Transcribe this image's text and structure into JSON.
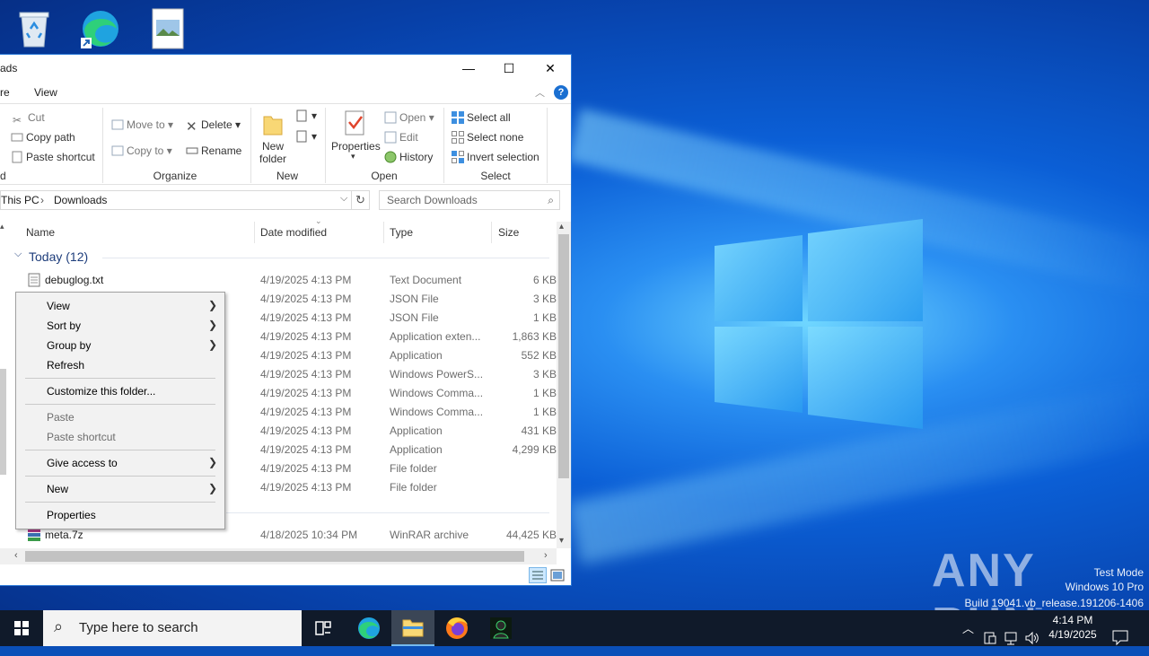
{
  "window": {
    "title": "ads",
    "tabs": [
      "re",
      "View"
    ],
    "minimize": "—",
    "maximize": "☐",
    "close": "✕"
  },
  "ribbon": {
    "clipboard": {
      "cut": "Cut",
      "copy_path": "Copy path",
      "paste_shortcut": "Paste shortcut",
      "group": "d"
    },
    "organize": {
      "move_to": "Move to",
      "copy_to": "Copy to",
      "delete": "Delete",
      "rename": "Rename",
      "group": "Organize"
    },
    "new": {
      "new_folder_line1": "New",
      "new_folder_line2": "folder",
      "group": "New"
    },
    "open": {
      "properties": "Properties",
      "open": "Open",
      "edit": "Edit",
      "history": "History",
      "group": "Open"
    },
    "select": {
      "select_all": "Select all",
      "select_none": "Select none",
      "invert": "Invert selection",
      "group": "Select"
    }
  },
  "address": {
    "path": [
      "This PC",
      "Downloads"
    ],
    "search_placeholder": "Search Downloads"
  },
  "columns": {
    "name": "Name",
    "date": "Date modified",
    "type": "Type",
    "size": "Size"
  },
  "group_today": "Today (12)",
  "files": [
    {
      "name": "debuglog.txt",
      "date": "4/19/2025 4:13 PM",
      "type": "Text Document",
      "size": "6 KB"
    },
    {
      "name": "",
      "date": "4/19/2025 4:13 PM",
      "type": "JSON File",
      "size": "3 KB"
    },
    {
      "name": "",
      "date": "4/19/2025 4:13 PM",
      "type": "JSON File",
      "size": "1 KB"
    },
    {
      "name": "",
      "date": "4/19/2025 4:13 PM",
      "type": "Application exten...",
      "size": "1,863 KB"
    },
    {
      "name": "",
      "date": "4/19/2025 4:13 PM",
      "type": "Application",
      "size": "552 KB"
    },
    {
      "name": "",
      "date": "4/19/2025 4:13 PM",
      "type": "Windows PowerS...",
      "size": "3 KB"
    },
    {
      "name": "",
      "date": "4/19/2025 4:13 PM",
      "type": "Windows Comma...",
      "size": "1 KB"
    },
    {
      "name": "",
      "date": "4/19/2025 4:13 PM",
      "type": "Windows Comma...",
      "size": "1 KB"
    },
    {
      "name": "",
      "date": "4/19/2025 4:13 PM",
      "type": "Application",
      "size": "431 KB"
    },
    {
      "name": "",
      "date": "4/19/2025 4:13 PM",
      "type": "Application",
      "size": "4,299 KB"
    },
    {
      "name": "",
      "date": "4/19/2025 4:13 PM",
      "type": "File folder",
      "size": ""
    },
    {
      "name": "",
      "date": "4/19/2025 4:13 PM",
      "type": "File folder",
      "size": ""
    },
    {
      "name": "meta.7z",
      "date": "4/18/2025 10:34 PM",
      "type": "WinRAR archive",
      "size": "44,425 KB"
    }
  ],
  "context_menu": {
    "view": "View",
    "sort_by": "Sort by",
    "group_by": "Group by",
    "refresh": "Refresh",
    "customize": "Customize this folder...",
    "paste": "Paste",
    "paste_shortcut": "Paste shortcut",
    "give_access": "Give access to",
    "new": "New",
    "properties": "Properties"
  },
  "taskbar": {
    "search_placeholder": "Type here to search",
    "time": "4:14 PM",
    "date": "4/19/2025"
  },
  "watermark": {
    "logo": "ANY RUN",
    "line1": "Test Mode",
    "line2": "Windows 10 Pro",
    "line3": "Build 19041.vb_release.191206-1406"
  },
  "colors": {
    "accent": "#0078d7",
    "taskbar": "#101a2a",
    "help": "#1a6fd1"
  }
}
